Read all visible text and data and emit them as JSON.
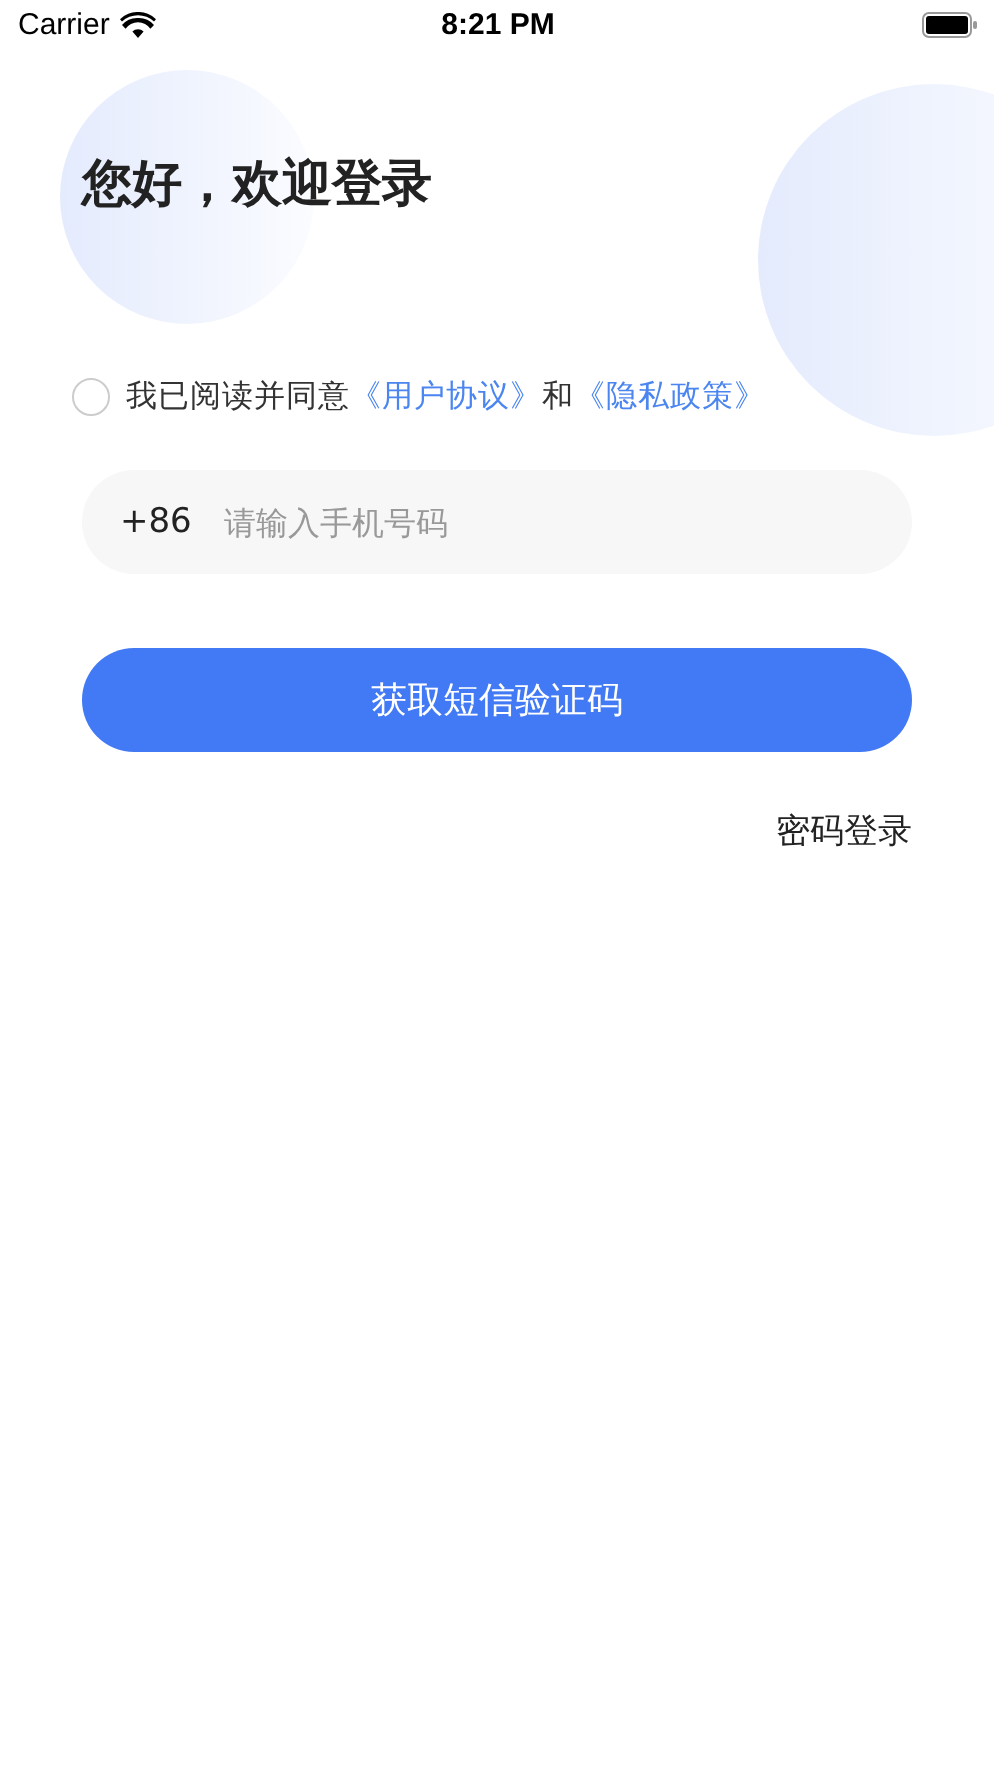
{
  "status_bar": {
    "carrier": "Carrier",
    "time": "8:21 PM"
  },
  "title": "您好，欢迎登录",
  "agreement": {
    "checked": false,
    "parts": [
      {
        "kind": "text",
        "text": "我已阅读并同意"
      },
      {
        "kind": "link",
        "text": "《用户协议》"
      },
      {
        "kind": "text",
        "text": "和"
      },
      {
        "kind": "link",
        "text": "《隐私政策》"
      }
    ]
  },
  "phone_field": {
    "prefix": "+86",
    "placeholder": "请输入手机号码"
  },
  "primary_button": "获取短信验证码",
  "password_login_link": "密码登录"
}
